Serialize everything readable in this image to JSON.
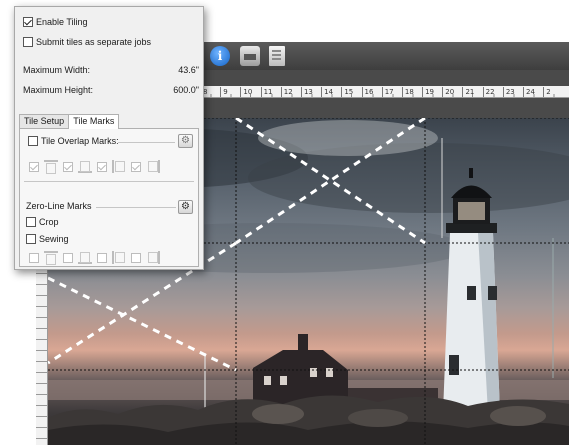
{
  "panel": {
    "enable_tiling": {
      "label": "Enable Tiling",
      "checked": true
    },
    "submit_tiles": {
      "label": "Submit tiles as separate jobs",
      "checked": false
    },
    "max_width": {
      "label": "Maximum Width:",
      "value": "43.6\""
    },
    "max_height": {
      "label": "Maximum Height:",
      "value": "600.0\""
    },
    "tabs": [
      {
        "label": "Tile Setup",
        "active": false
      },
      {
        "label": "Tile Marks",
        "active": true
      }
    ],
    "tile_overlap": {
      "label": "Tile Overlap Marks:",
      "checked": false,
      "settings_icon": "gear-icon"
    },
    "zero_line": {
      "label": "Zero-Line Marks",
      "settings_icon": "gear-icon",
      "crop": {
        "label": "Crop",
        "checked": false
      },
      "sewing": {
        "label": "Sewing",
        "checked": false
      }
    }
  },
  "toolbar": {
    "icons": [
      "info-icon",
      "print-icon",
      "document-icon"
    ],
    "info_glyph": "i"
  },
  "ruler": {
    "ticks": [
      "8",
      "9",
      "10",
      "11",
      "12",
      "13",
      "14",
      "15",
      "16",
      "17",
      "18",
      "19",
      "20",
      "21",
      "22",
      "23",
      "24",
      "2"
    ]
  },
  "colors": {
    "toolbar": "#4a4a4a",
    "panel_bg": "#f0f0f0",
    "tile_line": "#1a1a1a"
  }
}
